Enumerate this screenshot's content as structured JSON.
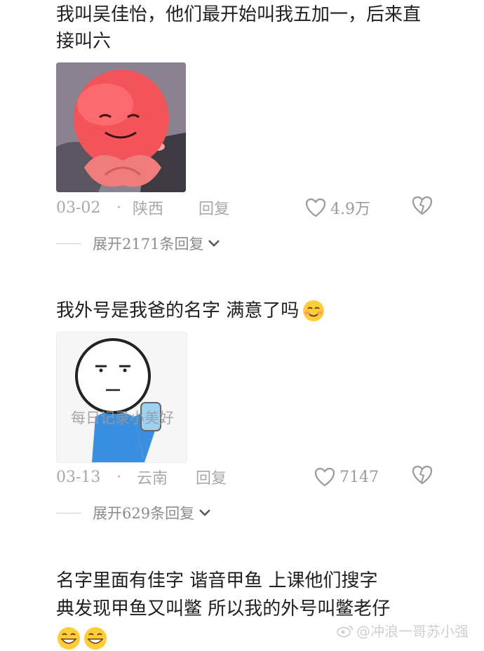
{
  "comments": [
    {
      "text": "我叫吴佳怡，他们最开始叫我五加一，后来直接叫六",
      "date": "03-02",
      "location": "陕西",
      "reply_label": "回复",
      "likes": "4.9万",
      "expand_label": "展开2171条回复"
    },
    {
      "text": "我外号是我爸的名字 满意了吗",
      "image_caption": "每日记录小美好",
      "date": "03-13",
      "location": "云南",
      "reply_label": "回复",
      "likes": "7147",
      "expand_label": "展开629条回复"
    },
    {
      "text_line1": "名字里面有佳字 谐音甲鱼 上课他们搜字",
      "text_line2": "典发现甲鱼又叫鳖 所以我的外号叫鳖老仔"
    }
  ],
  "separator_dot": "·",
  "watermark": "@冲浪一哥苏小强",
  "colors": {
    "meta_gray": "#a8a8a8",
    "text": "#1f1f1f"
  }
}
